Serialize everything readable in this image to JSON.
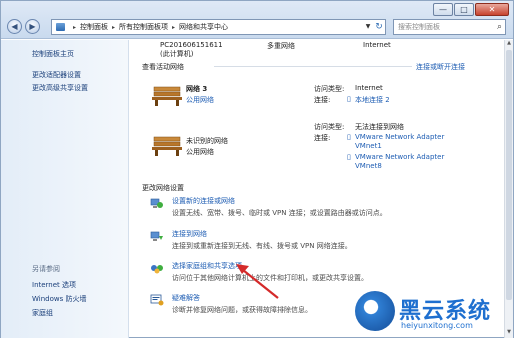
{
  "window": {
    "caption_minimize": "—",
    "caption_maximize": "□",
    "caption_close": "✕"
  },
  "toolbar": {
    "back": "◀",
    "forward": "▶",
    "breadcrumb": [
      "控制面板",
      "所有控制面板项",
      "网络和共享中心"
    ],
    "refresh": "↻",
    "search_placeholder": "搜索控制面板",
    "search_icon": "⌕"
  },
  "left_pane": {
    "home": "控制面板主页",
    "links": [
      "更改适配器设置",
      "更改高级共享设置"
    ],
    "see_also_title": "另请参阅",
    "see_also": [
      "Internet 选项",
      "Windows 防火墙",
      "家庭组"
    ]
  },
  "top_map": {
    "computer_name": "PC201606151611",
    "computer_sub": "(此计算机)",
    "middle": "多重网络",
    "right": "Internet"
  },
  "active_networks": {
    "title": "查看活动网络",
    "connect_link": "连接或断开连接",
    "networks": [
      {
        "name": "网络  3",
        "type": "公用网络",
        "access_label": "访问类型:",
        "access_value": "Internet",
        "conn_label": "连接:",
        "conn_values": [
          "本地连接 2"
        ]
      },
      {
        "name": "未识别的网络",
        "type": "公用网络",
        "access_label": "访问类型:",
        "access_value": "无法连接到网络",
        "conn_label": "连接:",
        "conn_values": [
          "VMware Network Adapter",
          "VMnet1",
          "VMware Network Adapter",
          "VMnet8"
        ]
      }
    ]
  },
  "change_settings": {
    "title": "更改网络设置",
    "tasks": [
      {
        "title": "设置新的连接或网络",
        "desc": "设置无线、宽带、拨号、临时或 VPN 连接；或设置路由器或访问点。"
      },
      {
        "title": "连接到网络",
        "desc": "连接到或重新连接到无线、有线、拨号或 VPN 网络连接。"
      },
      {
        "title": "选择家庭组和共享选项",
        "desc": "访问位于其他网络计算机上的文件和打印机，或更改共享设置。"
      },
      {
        "title": "疑难解答",
        "desc": "诊断并修复网络问题，或获得故障排除信息。"
      }
    ]
  },
  "watermark": {
    "brand": "黑云系统",
    "url": "heiyunxitong.com"
  },
  "colors": {
    "link": "#1e5db3",
    "arrow": "#d42a2a",
    "brand": "#1e6fcf"
  }
}
